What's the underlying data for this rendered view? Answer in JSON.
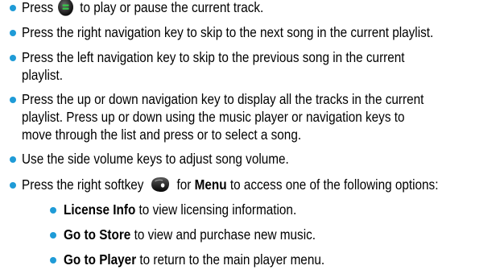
{
  "bullet_color": "#1f9bd7",
  "items": [
    {
      "before": "Press",
      "icon": "menu-ok-key-icon",
      "after": "to play or pause the current track."
    },
    {
      "line1": "Press the right navigation key to skip to the next song in the current playlist."
    },
    {
      "line1": "Press the left navigation key to skip to the previous song in the current",
      "line2": "playlist."
    },
    {
      "line1": "Press the up or down navigation key to display all the tracks in the current",
      "line2": "playlist. Press up or down using the music player or navigation keys to",
      "line3": "move through the list and press or to select a song."
    },
    {
      "line1": "Use the side volume keys to adjust song volume."
    },
    {
      "before": "Press the right softkey",
      "icon": "right-softkey-icon",
      "mid": "for",
      "bold": "Menu",
      "after": "to access one of the following options:"
    }
  ],
  "subitems": [
    {
      "bold": "License Info",
      "text": "to view licensing information."
    },
    {
      "bold": "Go to Store",
      "text": "to view and purchase new music."
    },
    {
      "bold": "Go to Player",
      "text": "to return to the main player menu."
    }
  ]
}
